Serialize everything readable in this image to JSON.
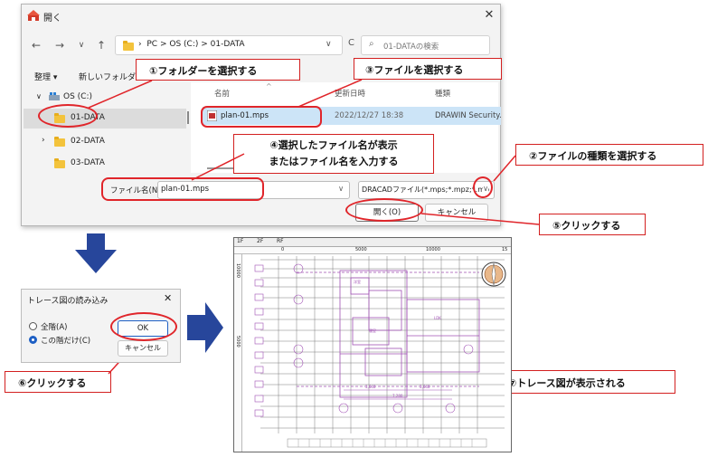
{
  "dialog": {
    "title": "開く",
    "close": "✕",
    "nav": {
      "back": "←",
      "forward": "→",
      "down": "∨",
      "up": "↑"
    },
    "breadcrumb": [
      "PC",
      ">",
      "OS (C:)",
      ">",
      "01-DATA"
    ],
    "refresh": "C",
    "search_placeholder": "01-DATAの検索",
    "organize": "整理 ▾",
    "new_folder": "新しいフォルダー",
    "sidebar": [
      {
        "label": "OS (C:)"
      },
      {
        "label": "01-DATA"
      },
      {
        "label": "02-DATA"
      },
      {
        "label": "03-DATA"
      }
    ],
    "columns": {
      "name": "名前",
      "modified": "更新日時",
      "type": "種類"
    },
    "file": {
      "name": "plan-01.mps",
      "modified": "2022/12/27 18:38",
      "type": "DRAWIN Security."
    },
    "filename_label": "ファイル名(N):",
    "filename_value": "plan-01.mps",
    "filetype_value": "DRACADファイル(*.mps;*.mpz;*.mp",
    "open_button": "開く(O)",
    "cancel_button": "キャンセル"
  },
  "callouts": {
    "c1": "①フォルダーを選択する",
    "c2": "②ファイルの種類を選択する",
    "c3": "③ファイルを選択する",
    "c4_line1": "④選択したファイル名が表示",
    "c4_line2": "またはファイル名を入力する",
    "c5": "⑤クリックする",
    "c6": "⑥クリックする",
    "c7": "⑦トレース図が表示される"
  },
  "trace_dialog": {
    "title": "トレース図の読み込み",
    "close": "✕",
    "opt_all": "全階(A)",
    "opt_this": "この階だけ(C)",
    "ok": "OK",
    "cancel": "キャンセル"
  },
  "cad": {
    "tabs": [
      "1F",
      "2F",
      "RF"
    ],
    "ruler_top": [
      "0",
      "5000",
      "10000",
      "15"
    ],
    "ruler_left": [
      "10000",
      "5000"
    ],
    "labels": {
      "dim1": "3,640",
      "dim2": "3,640",
      "dim3": "7,280",
      "room1": "洋室",
      "room2": "LDK",
      "room3": "寝室"
    }
  },
  "colors": {
    "red": "#e0252a",
    "blue_arrow": "#27469b",
    "selection": "#cce4f7",
    "cad_purple": "#a050b4"
  }
}
